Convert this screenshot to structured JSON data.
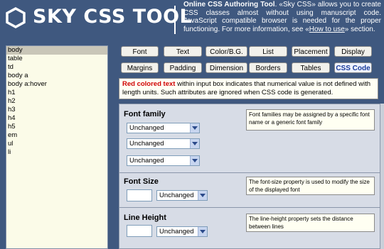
{
  "header": {
    "logo_text": "SKY CSS TOOL",
    "intro_title": "Online CSS Authoring Tool",
    "intro_body": ". «Sky CSS» allows you to create CSS classes almost without using manuscript code. JavaScript compatible browser is needed for the proper functioning. For more information, see «",
    "intro_link": "How to use",
    "intro_end": "» section."
  },
  "selectors": [
    "body",
    "table",
    "td",
    "body a",
    "body a:hover",
    "h1",
    "h2",
    "h3",
    "h4",
    "h5",
    "em",
    "ul",
    "li"
  ],
  "selected_selector": "body",
  "tabs_row1": [
    "Font",
    "Text",
    "Color/B.G.",
    "List",
    "Placement",
    "Display"
  ],
  "tabs_row2": [
    "Margins",
    "Padding",
    "Dimension",
    "Borders",
    "Tables",
    "CSS Code"
  ],
  "active_tab": "CSS Code",
  "note": {
    "red": "Red colored text",
    "rest": " within input box indicates that numerical value is not defined with length units. Such attributes are ignored when CSS code is generated."
  },
  "sections": {
    "font_family": {
      "title": "Font family",
      "hint": "Font families may be assigned by a specific font name or a generic font family",
      "select1": "Unchanged",
      "select2": "Unchanged",
      "select3": "Unchanged"
    },
    "font_size": {
      "title": "Font Size",
      "hint": "The font-size property is used to modify the size of the displayed font",
      "unit": "Unchanged"
    },
    "line_height": {
      "title": "Line Height",
      "hint": "The line-height property sets the distance between lines",
      "unit": "Unchanged"
    }
  },
  "colors": {
    "background": "#3f587f",
    "note_red": "#d00000",
    "active_tab": "#1a3b9a"
  }
}
